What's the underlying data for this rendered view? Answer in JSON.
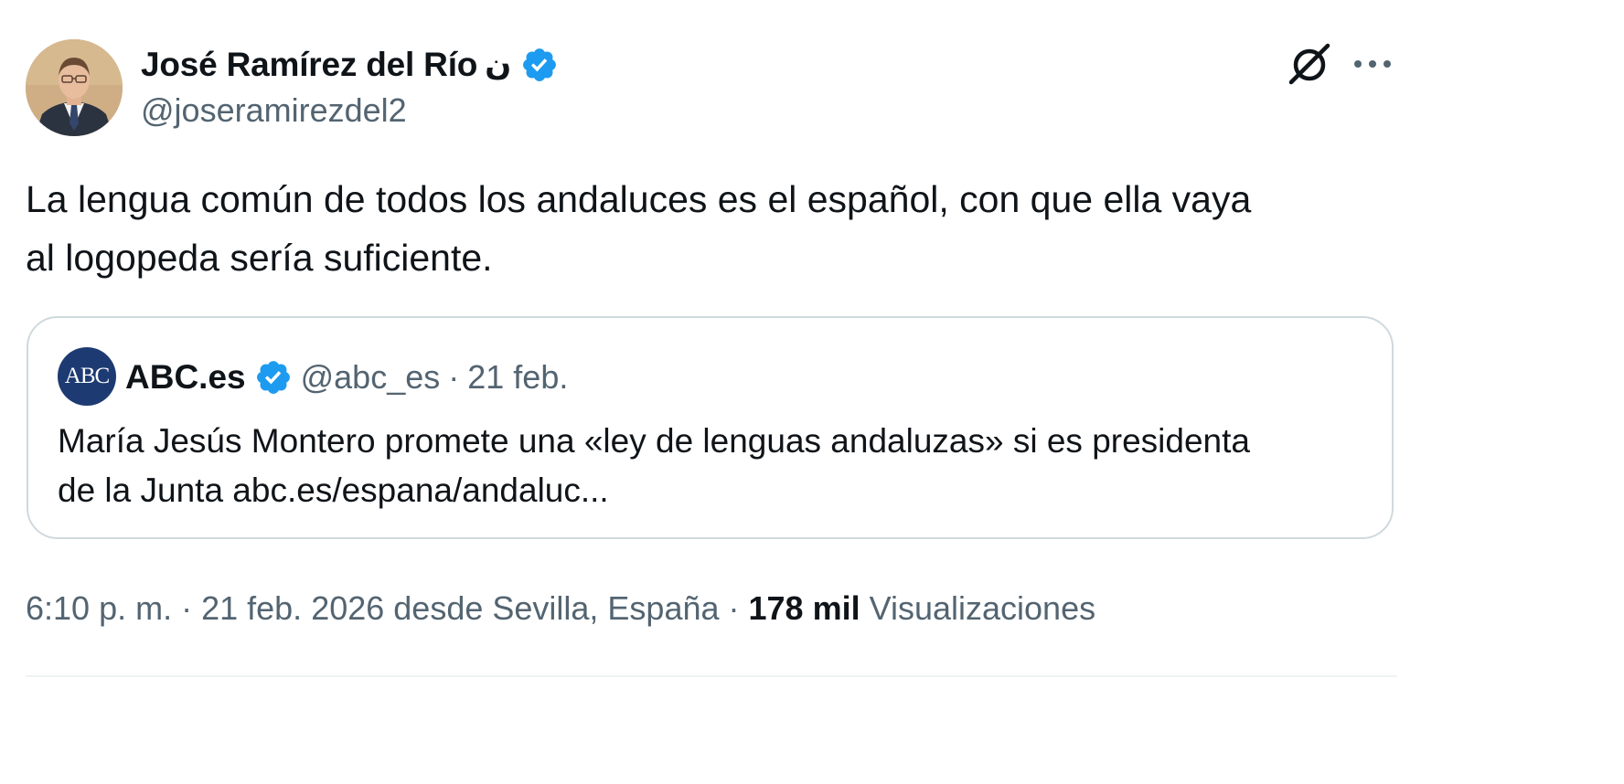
{
  "author": {
    "display_name": "José Ramírez del Río",
    "name_glyph": "ن",
    "handle": "@joseramirezdel2",
    "verified": true,
    "verified_color": "#1d9bf0"
  },
  "actions": {
    "grok_icon": "grok-icon",
    "more_icon": "more-icon"
  },
  "tweet": {
    "text_line_1": "La lengua común de todos los andaluces es el español, con que ella vaya",
    "text_line_2": "al logopeda sería suficiente."
  },
  "quoted": {
    "avatar_text": "ABC",
    "display_name": "ABC.es",
    "verified": true,
    "handle": "@abc_es",
    "separator": "·",
    "date": "21 feb.",
    "text_line_1": "María Jesús Montero promete una «ley de lenguas andaluzas» si es presidenta",
    "text_line_2": "de la Junta abc.es/espana/andaluc..."
  },
  "meta": {
    "time": "6:10 p. m.",
    "separator": "·",
    "date_location": "21 feb. 2026 desde Sevilla, España",
    "views_count": "178 mil",
    "views_label": "Visualizaciones"
  },
  "colors": {
    "text_primary": "#0f1419",
    "text_secondary": "#536471",
    "border": "#cfd9de",
    "abc_blue": "#1d3b72"
  }
}
